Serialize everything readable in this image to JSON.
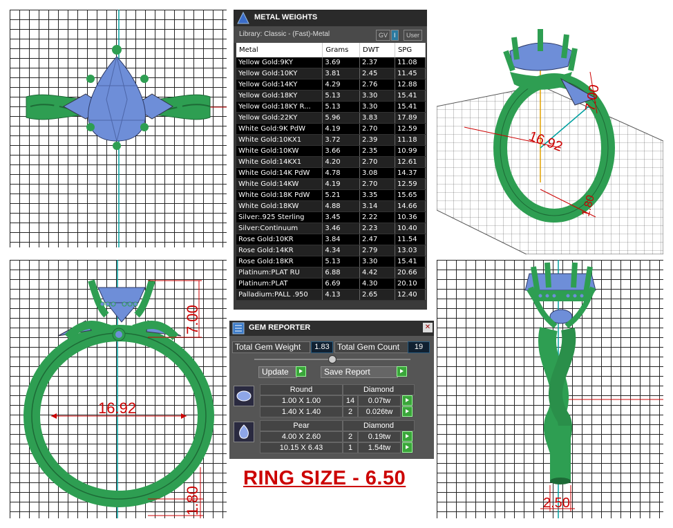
{
  "metal_weights": {
    "title": "METAL WEIGHTS",
    "library": "Library: Classic - (Fast)-Metal",
    "buttons": [
      "GV",
      "I",
      "User"
    ],
    "columns": [
      "Metal",
      "Grams",
      "DWT",
      "SPG"
    ],
    "rows": [
      [
        "Yellow Gold:9KY",
        "3.69",
        "2.37",
        "11.08"
      ],
      [
        "Yellow Gold:10KY",
        "3.81",
        "2.45",
        "11.45"
      ],
      [
        "Yellow Gold:14KY",
        "4.29",
        "2.76",
        "12.88"
      ],
      [
        "Yellow Gold:18KY",
        "5.13",
        "3.30",
        "15.41"
      ],
      [
        "Yellow Gold:18KY R...",
        "5.13",
        "3.30",
        "15.41"
      ],
      [
        "Yellow Gold:22KY",
        "5.96",
        "3.83",
        "17.89"
      ],
      [
        "White Gold:9K PdW",
        "4.19",
        "2.70",
        "12.59"
      ],
      [
        "White Gold:10KX1",
        "3.72",
        "2.39",
        "11.18"
      ],
      [
        "White Gold:10KW",
        "3.66",
        "2.35",
        "10.99"
      ],
      [
        "White Gold:14KX1",
        "4.20",
        "2.70",
        "12.61"
      ],
      [
        "White Gold:14K PdW",
        "4.78",
        "3.08",
        "14.37"
      ],
      [
        "White Gold:14KW",
        "4.19",
        "2.70",
        "12.59"
      ],
      [
        "White Gold:18K PdW",
        "5.21",
        "3.35",
        "15.65"
      ],
      [
        "White Gold:18KW",
        "4.88",
        "3.14",
        "14.66"
      ],
      [
        "Silver:.925 Sterling",
        "3.45",
        "2.22",
        "10.36"
      ],
      [
        "Silver:Continuum",
        "3.46",
        "2.23",
        "10.40"
      ],
      [
        "Rose Gold:10KR",
        "3.84",
        "2.47",
        "11.54"
      ],
      [
        "Rose Gold:14KR",
        "4.34",
        "2.79",
        "13.03"
      ],
      [
        "Rose Gold:18KR",
        "5.13",
        "3.30",
        "15.41"
      ],
      [
        "Platinum:PLAT RU",
        "6.88",
        "4.42",
        "20.66"
      ],
      [
        "Platinum:PLAT",
        "6.69",
        "4.30",
        "20.10"
      ],
      [
        "Palladium:PALL .950",
        "4.13",
        "2.65",
        "12.40"
      ]
    ]
  },
  "gem_reporter": {
    "title": "GEM REPORTER",
    "close_label": "✕",
    "total_gem_weight_label": "Total Gem Weight",
    "total_gem_weight": "1.83",
    "total_gem_count_label": "Total Gem Count",
    "total_gem_count": "19",
    "update_label": "Update",
    "save_report_label": "Save Report",
    "groups": [
      {
        "shape": "Round",
        "material": "Diamond",
        "rows": [
          {
            "size": "1.00 X 1.00",
            "count": "14",
            "weight": "0.07tw"
          },
          {
            "size": "1.40 X 1.40",
            "count": "2",
            "weight": "0.026tw"
          }
        ]
      },
      {
        "shape": "Pear",
        "material": "Diamond",
        "rows": [
          {
            "size": "4.00 X 2.60",
            "count": "2",
            "weight": "0.19tw"
          },
          {
            "size": "10.15 X 6.43",
            "count": "1",
            "weight": "1.54tw"
          }
        ]
      }
    ]
  },
  "dimensions": {
    "front_width": "16.92",
    "front_height": "7.00",
    "front_band": "1.80",
    "persp_width": "16.92",
    "persp_height": "7.00",
    "persp_band": "1.80",
    "side_band": "2.50"
  },
  "ring_size": "RING SIZE - 6.50",
  "colors": {
    "metal": "#2e9e52",
    "gem": "#6e8ed8",
    "dimension": "#cc0000",
    "axis": "#00a0a0"
  }
}
